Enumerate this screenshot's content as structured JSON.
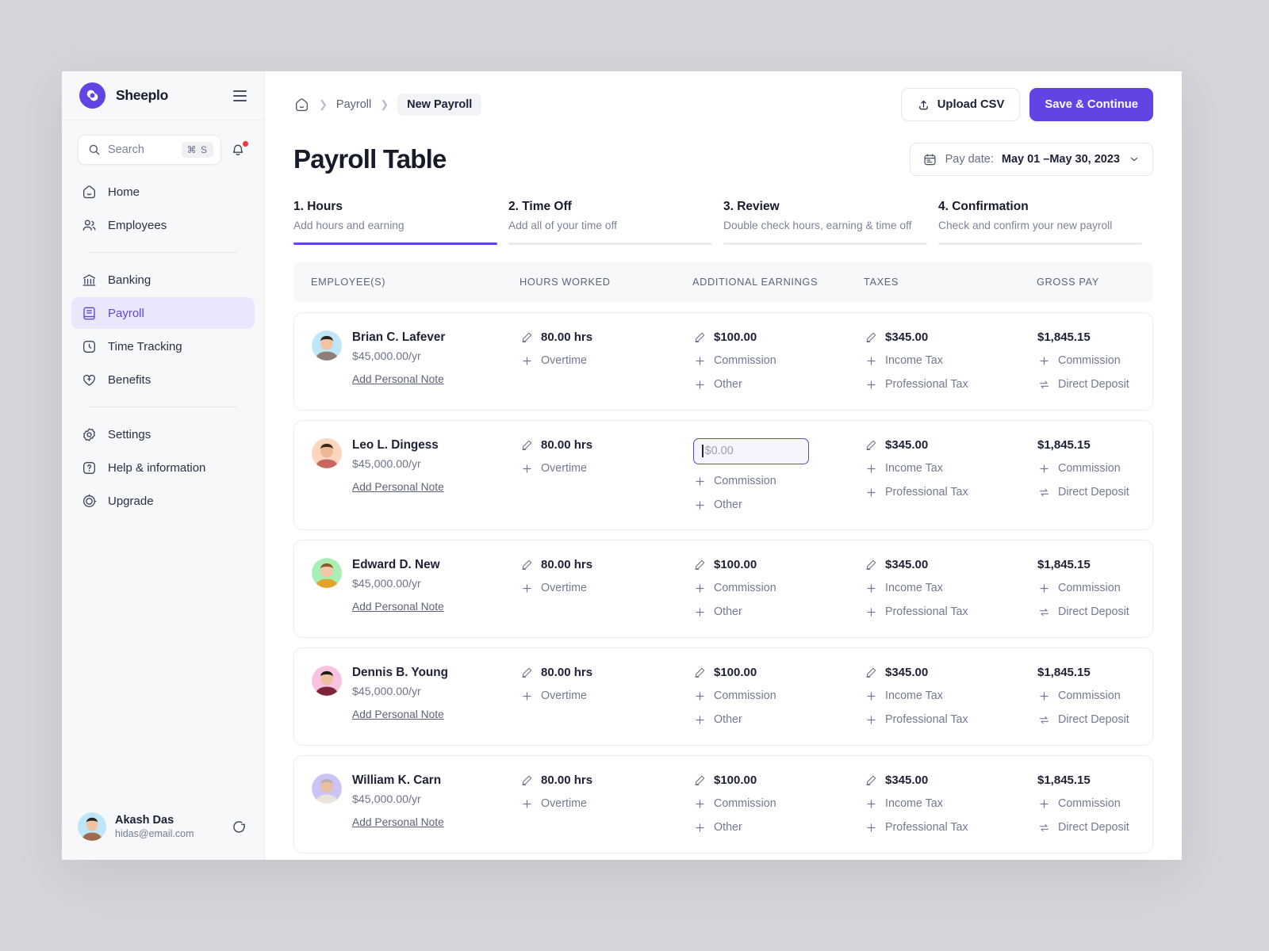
{
  "brand": {
    "name": "Sheeplo"
  },
  "sidebar": {
    "search": {
      "placeholder": "Search",
      "shortcut": "⌘ S"
    },
    "items": [
      {
        "label": "Home",
        "icon": "home-icon",
        "active": false
      },
      {
        "label": "Employees",
        "icon": "users-icon",
        "active": false
      },
      {
        "label": "Banking",
        "icon": "bank-icon",
        "active": false
      },
      {
        "label": "Payroll",
        "icon": "payroll-book-icon",
        "active": true
      },
      {
        "label": "Time Tracking",
        "icon": "clock-icon",
        "active": false
      },
      {
        "label": "Benefits",
        "icon": "heart-plus-icon",
        "active": false
      },
      {
        "label": "Settings",
        "icon": "gear-icon",
        "active": false
      },
      {
        "label": "Help & information",
        "icon": "question-icon",
        "active": false
      },
      {
        "label": "Upgrade",
        "icon": "upgrade-icon",
        "active": false
      }
    ],
    "user": {
      "name": "Akash Das",
      "email": "hidas@email.com"
    }
  },
  "breadcrumb": {
    "home": "home-icon",
    "parent": "Payroll",
    "current": "New Payroll"
  },
  "actions": {
    "upload": "Upload CSV",
    "save": "Save & Continue"
  },
  "header": {
    "title": "Payroll Table",
    "daterange_label": "Pay date:",
    "daterange_value": "May 01 –May 30, 2023"
  },
  "steps": [
    {
      "title": "1. Hours",
      "sub": "Add hours and earning",
      "active": true
    },
    {
      "title": "2. Time Off",
      "sub": "Add all of your time off",
      "active": false
    },
    {
      "title": "3. Review",
      "sub": "Double check hours, earning & time off",
      "active": false
    },
    {
      "title": "4. Confirmation",
      "sub": "Check and confirm your new payroll",
      "active": false
    }
  ],
  "columns": [
    "EMPLOYEE(S)",
    "HOURS WORKED",
    "ADDITIONAL EARNINGS",
    "TAXES",
    "GROSS PAY"
  ],
  "note_label": "Add Personal Note",
  "rows": [
    {
      "name": "Brian C. Lafever",
      "salary": "$45,000.00/yr",
      "avatar_bg": "#bfe6f7",
      "hours": "80.00 hrs",
      "hours_sub": "Overtime",
      "earnings": "$100.00",
      "earnings_editing": false,
      "earnings_placeholder": "$0.00",
      "earnings_sub1": "Commission",
      "earnings_sub2": "Other",
      "taxes": "$345.00",
      "taxes_sub1": "Income Tax",
      "taxes_sub2": "Professional Tax",
      "gross": "$1,845.15",
      "gross_sub1": "Commission",
      "gross_sub2": "Direct Deposit"
    },
    {
      "name": "Leo L. Dingess",
      "salary": "$45,000.00/yr",
      "avatar_bg": "#fbd5bc",
      "hours": "80.00 hrs",
      "hours_sub": "Overtime",
      "earnings": "",
      "earnings_editing": true,
      "earnings_placeholder": "$0.00",
      "earnings_sub1": "Commission",
      "earnings_sub2": "Other",
      "taxes": "$345.00",
      "taxes_sub1": "Income Tax",
      "taxes_sub2": "Professional Tax",
      "gross": "$1,845.15",
      "gross_sub1": "Commission",
      "gross_sub2": "Direct Deposit"
    },
    {
      "name": "Edward D. New",
      "salary": "$45,000.00/yr",
      "avatar_bg": "#a9eeb4",
      "hours": "80.00 hrs",
      "hours_sub": "Overtime",
      "earnings": "$100.00",
      "earnings_editing": false,
      "earnings_placeholder": "$0.00",
      "earnings_sub1": "Commission",
      "earnings_sub2": "Other",
      "taxes": "$345.00",
      "taxes_sub1": "Income Tax",
      "taxes_sub2": "Professional Tax",
      "gross": "$1,845.15",
      "gross_sub1": "Commission",
      "gross_sub2": "Direct Deposit"
    },
    {
      "name": "Dennis B. Young",
      "salary": "$45,000.00/yr",
      "avatar_bg": "#f9c2e0",
      "hours": "80.00 hrs",
      "hours_sub": "Overtime",
      "earnings": "$100.00",
      "earnings_editing": false,
      "earnings_placeholder": "$0.00",
      "earnings_sub1": "Commission",
      "earnings_sub2": "Other",
      "taxes": "$345.00",
      "taxes_sub1": "Income Tax",
      "taxes_sub2": "Professional Tax",
      "gross": "$1,845.15",
      "gross_sub1": "Commission",
      "gross_sub2": "Direct Deposit"
    },
    {
      "name": "William K. Carn",
      "salary": "$45,000.00/yr",
      "avatar_bg": "#ccc3f7",
      "hours": "80.00 hrs",
      "hours_sub": "Overtime",
      "earnings": "$100.00",
      "earnings_editing": false,
      "earnings_placeholder": "$0.00",
      "earnings_sub1": "Commission",
      "earnings_sub2": "Other",
      "taxes": "$345.00",
      "taxes_sub1": "Income Tax",
      "taxes_sub2": "Professional Tax",
      "gross": "$1,845.15",
      "gross_sub1": "Commission",
      "gross_sub2": "Direct Deposit"
    }
  ],
  "colors": {
    "accent": "#6244e5",
    "accent_soft": "#eae7fd",
    "notify": "#f5323f"
  }
}
